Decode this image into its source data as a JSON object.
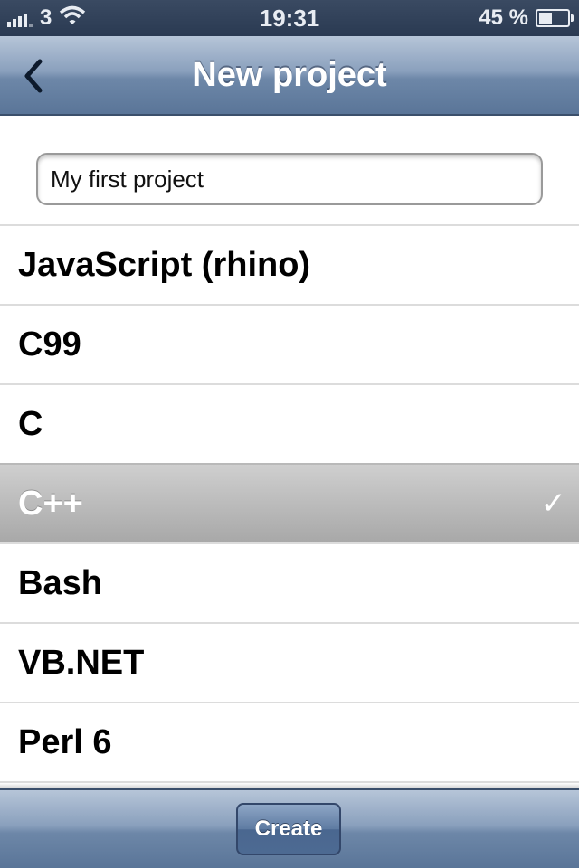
{
  "status_bar": {
    "carrier": "3",
    "time": "19:31",
    "battery_text": "45 %",
    "battery_level_percent": 45,
    "icons": [
      "signal-bars-icon",
      "wifi-icon",
      "battery-icon"
    ]
  },
  "nav": {
    "title": "New project",
    "back_icon": "chevron-left-icon"
  },
  "project_name": {
    "value": "My first project"
  },
  "languages": {
    "items": [
      {
        "label": "JavaScript (rhino)",
        "selected": false
      },
      {
        "label": "C99",
        "selected": false
      },
      {
        "label": "C",
        "selected": false
      },
      {
        "label": "C++",
        "selected": true,
        "check_glyph": "✓"
      },
      {
        "label": "Bash",
        "selected": false
      },
      {
        "label": "VB.NET",
        "selected": false
      },
      {
        "label": "Perl 6",
        "selected": false
      }
    ]
  },
  "toolbar": {
    "create_label": "Create"
  },
  "colors": {
    "bar_blue": "#6d87a8",
    "selected_gray": "#b9b9b9",
    "separator": "#dcdcdc"
  }
}
